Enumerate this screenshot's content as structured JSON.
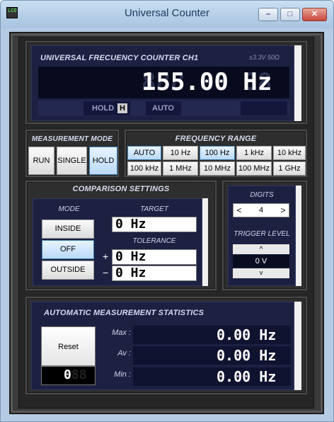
{
  "window": {
    "title": "Universal Counter",
    "icon_text": "LCD",
    "minimize": "–",
    "maximize": "□",
    "close": "✕"
  },
  "display": {
    "title": "UNIVERSAL FRECUENCY COUNTER CH1",
    "spec": "±3.3V 50Ω",
    "ghost": "888.88 88",
    "value": "155.00 Hz",
    "hold_label": "HOLD",
    "hold_indicator": "H",
    "auto_label": "AUTO"
  },
  "measurement_mode": {
    "title": "MEASUREMENT MODE",
    "buttons": [
      "RUN",
      "SINGLE",
      "HOLD"
    ],
    "selected": "HOLD"
  },
  "frequency_range": {
    "title": "FREQUENCY RANGE",
    "buttons": [
      "AUTO",
      "10 Hz",
      "100 Hz",
      "1 kHz",
      "10 kHz",
      "100 kHz",
      "1 MHz",
      "10 MHz",
      "100 MHz",
      "1 GHz"
    ],
    "selected": [
      "AUTO",
      "100 Hz"
    ]
  },
  "comparison": {
    "title": "COMPARISON SETTINGS",
    "mode_label": "MODE",
    "modes": [
      "INSIDE",
      "OFF",
      "OUTSIDE"
    ],
    "selected_mode": "OFF",
    "target_label": "TARGET",
    "target_value": "0 Hz",
    "tolerance_label": "TOLERANCE",
    "plus_sign": "+",
    "minus_sign": "−",
    "tol_plus": "0 Hz",
    "tol_minus": "0 Hz"
  },
  "digits": {
    "label": "DIGITS",
    "value": "4",
    "dec": "<",
    "inc": ">"
  },
  "trigger": {
    "label": "TRIGGER LEVEL",
    "value": "0 V",
    "up": "^",
    "down": "v"
  },
  "statistics": {
    "title": "AUTOMATIC MEASUREMENT STATISTICS",
    "reset_label": "Reset",
    "count": "0",
    "ghost": "888",
    "rows": [
      {
        "label": "Max :",
        "value": "0.00 Hz"
      },
      {
        "label": "Av :",
        "value": "0.00 Hz"
      },
      {
        "label": "Min :",
        "value": "0.00 Hz"
      }
    ]
  },
  "colors": {
    "panel_dark": "#262626",
    "display_bg": "#1c2142",
    "selected_button": "#b9d9f7"
  }
}
